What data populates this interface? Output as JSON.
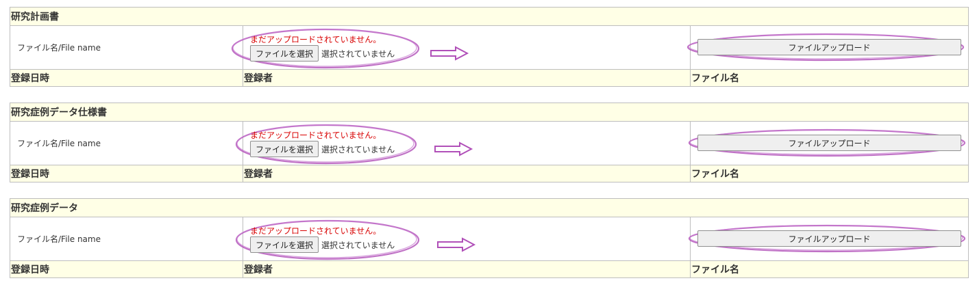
{
  "sections": [
    {
      "title": "研究計画書",
      "file_label": "ファイル名/File name",
      "status": "まだアップロードされていません。",
      "choose_label": "ファイルを選択",
      "no_file_text": "選択されていません",
      "upload_label": "ファイルアップロード",
      "col_date": "登録日時",
      "col_user": "登録者",
      "col_name": "ファイル名"
    },
    {
      "title": "研究症例データ仕様書",
      "file_label": "ファイル名/File name",
      "status": "まだアップロードされていません。",
      "choose_label": "ファイルを選択",
      "no_file_text": "選択されていません",
      "upload_label": "ファイルアップロード",
      "col_date": "登録日時",
      "col_user": "登録者",
      "col_name": "ファイル名"
    },
    {
      "title": "研究症例データ",
      "file_label": "ファイル名/File name",
      "status": "まだアップロードされていません。",
      "choose_label": "ファイルを選択",
      "no_file_text": "選択されていません",
      "upload_label": "ファイルアップロード",
      "col_date": "登録日時",
      "col_user": "登録者",
      "col_name": "ファイル名"
    }
  ],
  "colors": {
    "header_bg": "#ffffe6",
    "status_red": "#d80000",
    "annotation_purple": "#b04fb8"
  }
}
